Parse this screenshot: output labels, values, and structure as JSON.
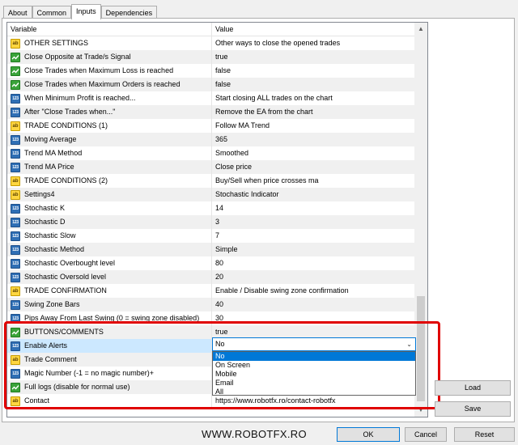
{
  "tabs": [
    "About",
    "Common",
    "Inputs",
    "Dependencies"
  ],
  "active_tab": "Inputs",
  "grid": {
    "headers": {
      "variable": "Variable",
      "value": "Value"
    },
    "rows": [
      {
        "icon": "ab",
        "variable": "OTHER SETTINGS",
        "value": "Other ways to close the opened trades"
      },
      {
        "icon": "bool",
        "variable": "Close Opposite at Trade/s Signal",
        "value": "true"
      },
      {
        "icon": "bool",
        "variable": "Close Trades when Maximum Loss is reached",
        "value": "false"
      },
      {
        "icon": "bool",
        "variable": "Close Trades when Maximum Orders is reached",
        "value": "false"
      },
      {
        "icon": "123",
        "variable": "When Minimum Profit is reached...",
        "value": "Start closing ALL trades on the chart"
      },
      {
        "icon": "123",
        "variable": "After \"Close Trades when...\"",
        "value": "Remove the EA from the chart"
      },
      {
        "icon": "ab",
        "variable": "TRADE CONDITIONS (1)",
        "value": "Follow MA Trend"
      },
      {
        "icon": "123",
        "variable": "Moving Average",
        "value": "365"
      },
      {
        "icon": "123",
        "variable": "Trend MA Method",
        "value": "Smoothed"
      },
      {
        "icon": "123",
        "variable": "Trend MA Price",
        "value": "Close price"
      },
      {
        "icon": "ab",
        "variable": "TRADE CONDITIONS (2)",
        "value": "Buy/Sell when price crosses ma"
      },
      {
        "icon": "ab",
        "variable": "Settings4",
        "value": "Stochastic Indicator"
      },
      {
        "icon": "123",
        "variable": "Stochastic K",
        "value": "14"
      },
      {
        "icon": "123",
        "variable": "Stochastic D",
        "value": "3"
      },
      {
        "icon": "123",
        "variable": "Stochastic Slow",
        "value": "7"
      },
      {
        "icon": "123",
        "variable": "Stochastic Method",
        "value": "Simple"
      },
      {
        "icon": "123",
        "variable": "Stochastic Overbought level",
        "value": "80"
      },
      {
        "icon": "123",
        "variable": "Stochastic Oversold level",
        "value": "20"
      },
      {
        "icon": "ab",
        "variable": "TRADE CONFIRMATION",
        "value": "Enable / Disable swing zone confirmation"
      },
      {
        "icon": "123",
        "variable": "Swing Zone Bars",
        "value": "40"
      },
      {
        "icon": "123",
        "variable": "Pips Away From Last Swing (0 = swing zone disabled)",
        "value": "30"
      },
      {
        "icon": "bool",
        "variable": "BUTTONS/COMMENTS",
        "value": "true"
      },
      {
        "icon": "123",
        "variable": "Enable Alerts",
        "value": ""
      },
      {
        "icon": "ab",
        "variable": "Trade Comment",
        "value": ""
      },
      {
        "icon": "123",
        "variable": "Magic Number (-1 = no magic number)+",
        "value": ""
      },
      {
        "icon": "bool",
        "variable": "Full logs (disable for normal use)",
        "value": ""
      },
      {
        "icon": "ab",
        "variable": "Contact",
        "value": "https://www.robotfx.ro/contact-robotfx"
      }
    ],
    "selected_row_index": 22
  },
  "combo": {
    "value": "No",
    "options": [
      "No",
      "On Screen",
      "Mobile",
      "Email",
      "All"
    ],
    "selected_option": "No"
  },
  "buttons": {
    "load": "Load",
    "save": "Save",
    "ok": "OK",
    "cancel": "Cancel",
    "reset": "Reset"
  },
  "brand_text": "WWW.ROBOTFX.RO",
  "colors": {
    "highlight": "#e00000",
    "selection": "#0078d7",
    "selected_row": "#cce8ff"
  }
}
